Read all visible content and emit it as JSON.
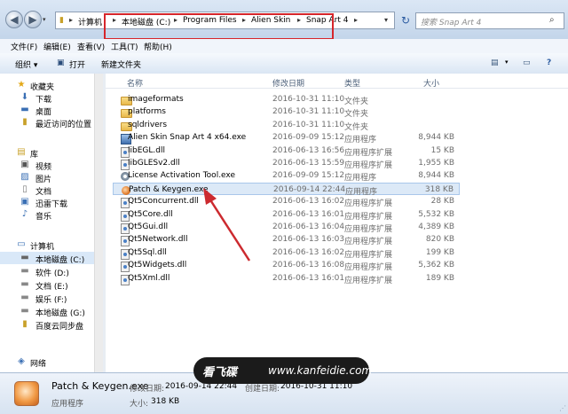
{
  "window": {
    "back_icon": "back-arrow-icon",
    "forward_icon": "forward-arrow-icon"
  },
  "address": {
    "crumbs": [
      "计算机",
      "本地磁盘 (C:)",
      "Program Files",
      "Alien Skin",
      "Snap Art 4"
    ],
    "highlight_color": "#d6262b"
  },
  "search": {
    "placeholder": "搜索 Snap Art 4"
  },
  "menu": {
    "file": "文件(F)",
    "edit": "编辑(E)",
    "view": "查看(V)",
    "tools": "工具(T)",
    "help": "帮助(H)"
  },
  "toolbar": {
    "organize": "组织 ▾",
    "open": "打开",
    "new_folder": "新建文件夹"
  },
  "nav": {
    "favorites": "收藏夹",
    "favorites_items": [
      "下载",
      "桌面",
      "最近访问的位置"
    ],
    "libraries": "库",
    "library_items": [
      "视频",
      "图片",
      "文档",
      "迅雷下载",
      "音乐"
    ],
    "computer": "计算机",
    "computer_items": [
      "本地磁盘 (C:)",
      "软件 (D:)",
      "文档 (E:)",
      "娱乐 (F:)",
      "本地磁盘 (G:)",
      "百度云同步盘"
    ],
    "network": "网络"
  },
  "columns": {
    "name": "名称",
    "date": "修改日期",
    "type": "类型",
    "size": "大小"
  },
  "files": [
    {
      "name": "imageformats",
      "date": "2016-10-31 11:10",
      "type": "文件夹",
      "size": "",
      "icon": "folder"
    },
    {
      "name": "platforms",
      "date": "2016-10-31 11:10",
      "type": "文件夹",
      "size": "",
      "icon": "folder"
    },
    {
      "name": "sqldrivers",
      "date": "2016-10-31 11:10",
      "type": "文件夹",
      "size": "",
      "icon": "folder"
    },
    {
      "name": "Alien Skin Snap Art 4 x64.exe",
      "date": "2016-09-09 15:12",
      "type": "应用程序",
      "size": "8,944 KB",
      "icon": "exe"
    },
    {
      "name": "libEGL.dll",
      "date": "2016-06-13 16:56",
      "type": "应用程序扩展",
      "size": "15 KB",
      "icon": "dll"
    },
    {
      "name": "libGLESv2.dll",
      "date": "2016-06-13 15:59",
      "type": "应用程序扩展",
      "size": "1,955 KB",
      "icon": "dll"
    },
    {
      "name": "License Activation Tool.exe",
      "date": "2016-09-09 15:12",
      "type": "应用程序",
      "size": "8,944 KB",
      "icon": "gear"
    },
    {
      "name": "Patch & Keygen.exe",
      "date": "2016-09-14 22:44",
      "type": "应用程序",
      "size": "318 KB",
      "icon": "patch"
    },
    {
      "name": "Qt5Concurrent.dll",
      "date": "2016-06-13 16:02",
      "type": "应用程序扩展",
      "size": "28 KB",
      "icon": "dll"
    },
    {
      "name": "Qt5Core.dll",
      "date": "2016-06-13 16:01",
      "type": "应用程序扩展",
      "size": "5,532 KB",
      "icon": "dll"
    },
    {
      "name": "Qt5Gui.dll",
      "date": "2016-06-13 16:04",
      "type": "应用程序扩展",
      "size": "4,389 KB",
      "icon": "dll"
    },
    {
      "name": "Qt5Network.dll",
      "date": "2016-06-13 16:03",
      "type": "应用程序扩展",
      "size": "820 KB",
      "icon": "dll"
    },
    {
      "name": "Qt5Sql.dll",
      "date": "2016-06-13 16:02",
      "type": "应用程序扩展",
      "size": "199 KB",
      "icon": "dll"
    },
    {
      "name": "Qt5Widgets.dll",
      "date": "2016-06-13 16:08",
      "type": "应用程序扩展",
      "size": "5,362 KB",
      "icon": "dll"
    },
    {
      "name": "Qt5Xml.dll",
      "date": "2016-06-13 16:01",
      "type": "应用程序扩展",
      "size": "189 KB",
      "icon": "dll"
    }
  ],
  "status": {
    "file_name": "Patch & Keygen.exe",
    "modified_label": "修改日期:",
    "modified_value": "2016-09-14 22:44",
    "created_label": "创建日期:",
    "created_value": "2016-10-31 11:10",
    "type": "应用程序",
    "size_label": "大小:",
    "size_value": "318 KB"
  },
  "watermark": {
    "brand": "看飞碟",
    "url": "www.kanfeidie.com"
  },
  "colors": {
    "selected_row": "#dce9f7",
    "arrow": "#cc2a2f"
  }
}
